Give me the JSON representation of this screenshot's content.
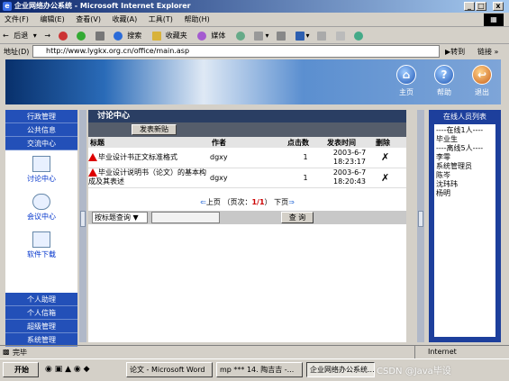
{
  "window": {
    "title": "企业网络办公系统 - Microsoft Internet Explorer",
    "minimize": "_",
    "maximize": "□",
    "close": "x"
  },
  "menu": [
    "文件(F)",
    "编辑(E)",
    "查看(V)",
    "收藏(A)",
    "工具(T)",
    "帮助(H)"
  ],
  "toolbar": {
    "back": "后退",
    "forward": "→",
    "search": "搜索",
    "favorites": "收藏夹",
    "media": "媒体"
  },
  "address": {
    "label": "地址(D)",
    "url": "http://www.lygkx.org.cn/office/main.asp",
    "go": "转到",
    "links": "链接"
  },
  "banner": {
    "home": "主页",
    "help": "帮助",
    "exit": "退出"
  },
  "sidebar": {
    "top_items": [
      "行政管理",
      "公共信息",
      "交流中心"
    ],
    "tools": [
      "讨论中心",
      "会议中心",
      "软件下载"
    ],
    "bottom_items": [
      "个人助理",
      "个人信箱",
      "超级管理",
      "系统管理"
    ]
  },
  "main": {
    "title": "讨论中心",
    "new_post": "发表新贴",
    "columns": [
      "标题",
      "作者",
      "点击数",
      "发表时间",
      "删除"
    ],
    "rows": [
      {
        "title": "毕业设计书正文标准格式",
        "author": "dgxy",
        "clicks": "1",
        "date": "2003-6-7",
        "time": "18:23:17",
        "delete": "✗"
      },
      {
        "title": "毕业设计说明书（论文）的基本构成及其表述",
        "author": "dgxy",
        "clicks": "1",
        "date": "2003-6-7",
        "time": "18:20:43",
        "delete": "✗"
      }
    ],
    "pager": {
      "prev": "上页",
      "pages_label": "（页次：",
      "pages": "1/1",
      "pages_end": "）",
      "next": "下页"
    },
    "search": {
      "select": "按标题查询",
      "button": "查 询"
    }
  },
  "online": {
    "title": "在线人员列表",
    "lines": [
      "----在线1人----",
      "毕业生",
      "----离线5人----",
      "李零",
      "系统管理员",
      "陈岑",
      "沈玮玮",
      "杨明"
    ]
  },
  "status": {
    "left": "完毕",
    "zone": "Internet"
  },
  "taskbar": {
    "start": "开始",
    "tasks": [
      "论文 - Microsoft Word",
      "mp *** 14. 陶吉吉 -...",
      "企业网络办公系统..."
    ],
    "watermark": "CSDN @Java毕设"
  }
}
